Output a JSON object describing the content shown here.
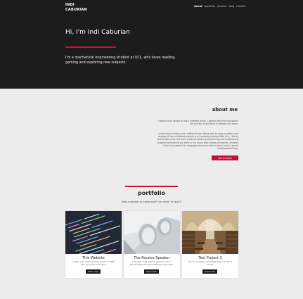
{
  "header": {
    "brand_line1": "INDI",
    "brand_line2": "CABURIAN",
    "nav": [
      "about",
      "portfolio",
      "resume",
      "blog",
      "contact"
    ]
  },
  "hero": {
    "title": "Hi, I'm Indi Caburian",
    "subtitle": "I'm a mechanical engineering student at UCL, who loves reading, gaming and exploring new subjects."
  },
  "about": {
    "title": "about me",
    "p1": "I aspire to be skilled in many different areas. I believe that the foundation for success in anything is passion and drive.",
    "p2": "I really enjoy making and crafting things. Being able to grow a project and develop it into a finished product is an amazing feeling! With this, I like to spend alot of my free time creating various programming and engineering projects and honing my skills in my many other areas of interest, whether that's my passion for language-learning or the endless hours I spend drawing/sketching.",
    "cta": "Get In Touch"
  },
  "portfolio": {
    "title": "portfolio",
    "subtitle": "Take a gander at some stuff I've done. Or don't.",
    "cards": [
      {
        "title": "This Website",
        "desc": "A static site I built using the power of HTML, CSS, JS, Python and Flask.",
        "button": "Have a look"
      },
      {
        "title": "The Passive Speaker",
        "desc": "A speaker, built without electronics for a Personal Business & Entrepreneurship class.",
        "button": "Have a look"
      },
      {
        "title": "Test Project 3",
        "desc": "Short description about Test Project 3, which I made.",
        "button": "Have a look"
      }
    ]
  },
  "colors": {
    "accent": "#c4103a",
    "dark": "#1c1c1c",
    "background": "#ececec"
  }
}
